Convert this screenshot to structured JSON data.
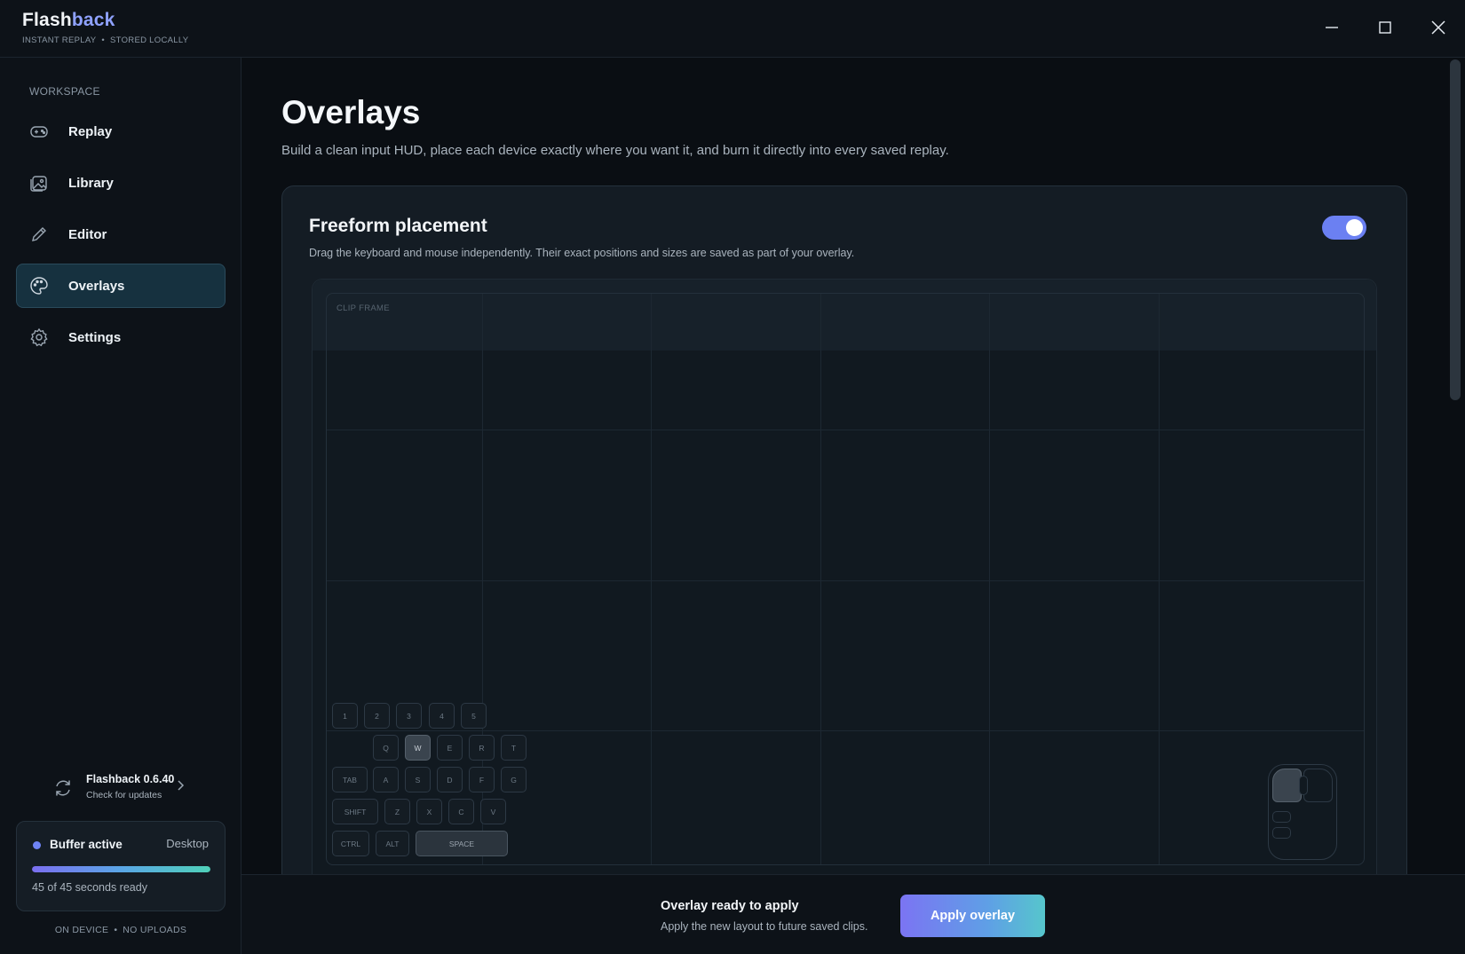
{
  "app": {
    "name_part1": "Flash",
    "name_part2": "back",
    "subtitle_left": "INSTANT REPLAY",
    "subtitle_dot": "•",
    "subtitle_right": "STORED LOCALLY"
  },
  "window_controls": {
    "minimize": "minimize-icon",
    "maximize": "maximize-icon",
    "close": "close-icon"
  },
  "sidebar": {
    "section_label": "WORKSPACE",
    "items": [
      {
        "label": "Replay",
        "icon": "gamepad-icon",
        "active": false
      },
      {
        "label": "Library",
        "icon": "image-library-icon",
        "active": false
      },
      {
        "label": "Editor",
        "icon": "pencil-icon",
        "active": false
      },
      {
        "label": "Overlays",
        "icon": "palette-icon",
        "active": true
      },
      {
        "label": "Settings",
        "icon": "gear-icon",
        "active": false
      }
    ],
    "update": {
      "title": "Flashback 0.6.40",
      "subtitle": "Check for updates"
    },
    "buffer": {
      "title": "Buffer active",
      "mode": "Desktop",
      "progress": 1.0,
      "status": "45 of 45 seconds ready"
    },
    "footer": {
      "left": "ON DEVICE",
      "dot": "•",
      "right": "NO UPLOADS"
    }
  },
  "main": {
    "title": "Overlays",
    "subtitle": "Build a clean input HUD, place each device exactly where you want it, and burn it directly into every saved replay.",
    "card": {
      "title": "Freeform placement",
      "subtitle": "Drag the keyboard and mouse independently. Their exact positions and sizes are saved as part of your overlay.",
      "toggle_on": true,
      "frame_label": "CLIP FRAME",
      "keyboard": {
        "row1": [
          "1",
          "2",
          "3",
          "4",
          "5"
        ],
        "row2": [
          "Q",
          "W",
          "E",
          "R",
          "T"
        ],
        "row3": [
          "TAB",
          "A",
          "S",
          "D",
          "F",
          "G"
        ],
        "row4": [
          "SHIFT",
          "Z",
          "X",
          "C",
          "V"
        ],
        "row5": [
          "CTRL",
          "ALT",
          "SPACE"
        ],
        "pressed": [
          "W",
          "SPACE"
        ]
      },
      "mouse": {
        "pressed": "left-button"
      }
    }
  },
  "actionbar": {
    "title": "Overlay ready to apply",
    "subtitle": "Apply the new layout to future saved clips.",
    "button": "Apply overlay"
  },
  "colors": {
    "accent": "#6b80f2",
    "brand_highlight": "#8fa2ff",
    "background": "#0a0e13",
    "sidebar": "#0d1218",
    "card": "#141c24"
  }
}
